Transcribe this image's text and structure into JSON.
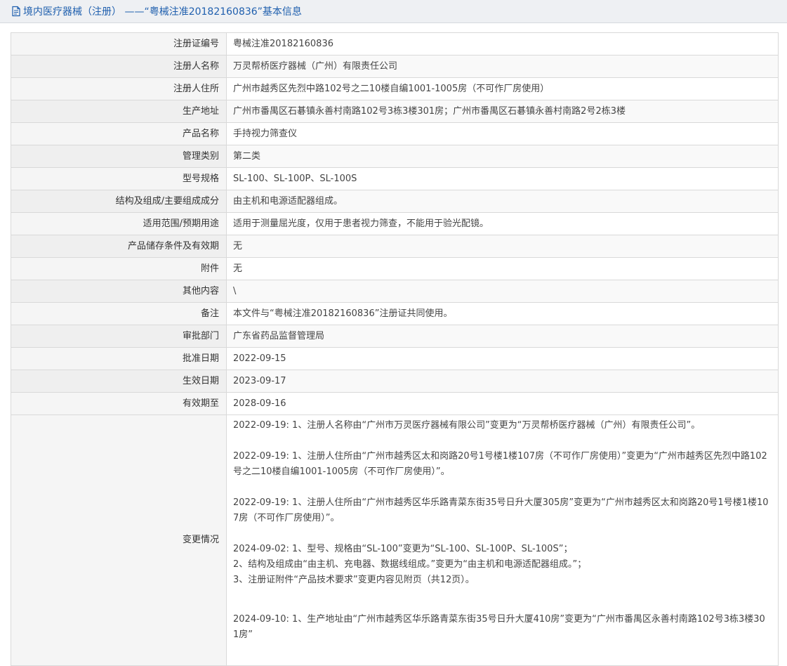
{
  "header": {
    "title": "境内医疗器械（注册） ——“粤械注准20182160836”基本信息",
    "accent": "#1f5fae"
  },
  "rows": [
    {
      "label": "注册证编号",
      "value": "粤械注准20182160836"
    },
    {
      "label": "注册人名称",
      "value": "万灵帮桥医疗器械（广州）有限责任公司"
    },
    {
      "label": "注册人住所",
      "value": "广州市越秀区先烈中路102号之二10楼自编1001-1005房（不可作厂房使用）"
    },
    {
      "label": "生产地址",
      "value": "广州市番禺区石碁镇永善村南路102号3栋3楼301房；广州市番禺区石碁镇永善村南路2号2栋3楼"
    },
    {
      "label": "产品名称",
      "value": "手持视力筛查仪"
    },
    {
      "label": "管理类别",
      "value": "第二类"
    },
    {
      "label": "型号规格",
      "value": "SL-100、SL-100P、SL-100S"
    },
    {
      "label": "结构及组成/主要组成成分",
      "value": "由主机和电源适配器组成。"
    },
    {
      "label": "适用范围/预期用途",
      "value": "适用于测量屈光度，仅用于患者视力筛查，不能用于验光配镜。"
    },
    {
      "label": "产品储存条件及有效期",
      "value": "无"
    },
    {
      "label": "附件",
      "value": "无"
    },
    {
      "label": "其他内容",
      "value": "\\"
    },
    {
      "label": "备注",
      "value": "本文件与“粤械注准20182160836”注册证共同使用。"
    },
    {
      "label": "审批部门",
      "value": "广东省药品监督管理局"
    },
    {
      "label": "批准日期",
      "value": "2022-09-15"
    },
    {
      "label": "生效日期",
      "value": "2023-09-17"
    },
    {
      "label": "有效期至",
      "value": "2028-09-16"
    }
  ],
  "changes": {
    "label": "变更情况",
    "entries": [
      {
        "lines": [
          "2022-09-19: 1、注册人名称由“广州市万灵医疗器械有限公司”变更为“万灵帮桥医疗器械（广州）有限责任公司”。"
        ]
      },
      {
        "lines": [
          "2022-09-19: 1、注册人住所由“广州市越秀区太和岗路20号1号楼1楼107房（不可作厂房使用）”变更为“广州市越秀区先烈中路102号之二10楼自编1001-1005房（不可作厂房使用）”。"
        ]
      },
      {
        "lines": [
          "2022-09-19: 1、注册人住所由“广州市越秀区华乐路青菜东街35号日升大厦305房”变更为“广州市越秀区太和岗路20号1号楼1楼107房（不可作厂房使用）”。"
        ]
      },
      {
        "lines": [
          "2024-09-02: 1、型号、规格由“SL-100”变更为“SL-100、SL-100P、SL-100S”；",
          "2、结构及组成由“由主机、充电器、数据线组成。”变更为“由主机和电源适配器组成。”；",
          "3、注册证附件“产品技术要求”变更内容见附页（共12页）。"
        ]
      },
      {
        "lines": [
          "2024-09-10: 1、生产地址由“广州市越秀区华乐路青菜东街35号日升大厦410房”变更为“广州市番禺区永善村南路102号3栋3楼301房”"
        ]
      }
    ]
  }
}
